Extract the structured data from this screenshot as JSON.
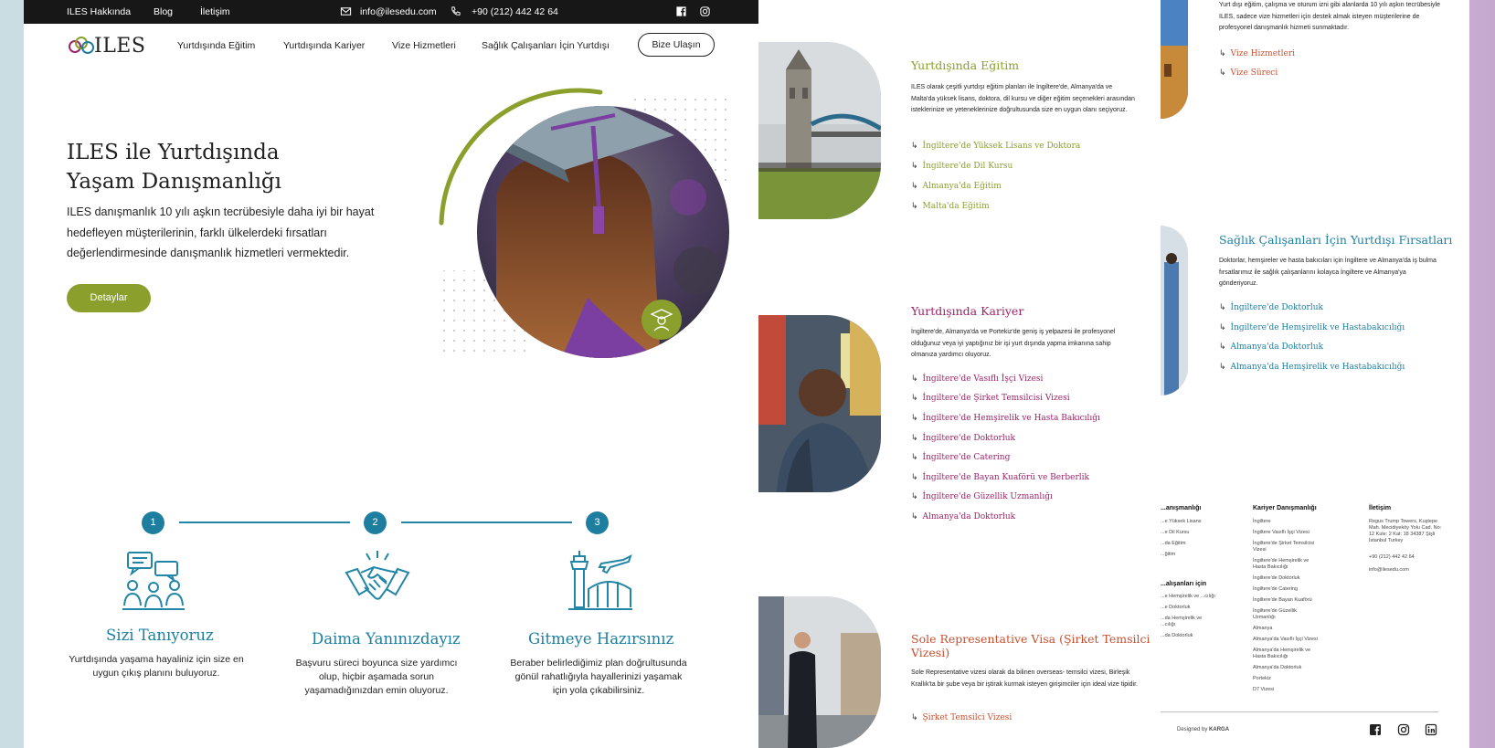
{
  "topbar": {
    "links": [
      "ILES Hakkında",
      "Blog",
      "İletişim"
    ],
    "email": "info@ilesedu.com",
    "phone": "+90 (212) 442 42 64"
  },
  "header": {
    "logo_text": "ILES",
    "nav": [
      "Yurtdışında Eğitim",
      "Yurtdışında Kariyer",
      "Vize Hizmetleri",
      "Sağlık Çalışanları İçin Yurtdışı"
    ],
    "cta": "Bize Ulaşın"
  },
  "hero": {
    "title_line1": "ILES ile Yurtdışında",
    "title_line2": "Yaşam Danışmanlığı",
    "text": "ILES danışmanlık 10 yılı aşkın tecrübesiyle daha iyi bir hayat hedefleyen müşterilerinin, farklı ülkelerdeki fırsatları değerlendirmesinde danışmanlık hizmetleri vermektedir.",
    "button": "Detaylar"
  },
  "steps": [
    "1",
    "2",
    "3"
  ],
  "features": [
    {
      "title": "Sizi Tanıyoruz",
      "text": "Yurtdışında yaşama hayaliniz için size en uygun çıkış planını buluyoruz."
    },
    {
      "title": "Daima Yanınızdayız",
      "text": "Başvuru süreci boyunca size yardımcı olup, hiçbir aşamada sorun yaşamadığınızdan emin oluyoruz."
    },
    {
      "title": "Gitmeye Hazırsınız",
      "text": "Beraber belirlediğimiz plan doğrultusunda gönül rahatlığıyla hayallerinizi yaşamak için yola çıkabilirsiniz."
    }
  ],
  "sections": [
    {
      "title": "Yurtdışında Eğitim",
      "text": "ILES olarak çeşitli yurtdışı eğitim planları ile İngiltere'de, Almanya'da ve Malta'da yüksek lisans, doktora, dil kursu ve diğer eğitim seçenekleri arasından isteklerinize ve yeteneklerinize doğrultusunda size en uygun olanı seçiyoruz.",
      "links": [
        "İngiltere'de Yüksek Lisans ve Doktora",
        "İngiltere'de Dil Kursu",
        "Almanya'da Eğitim",
        "Malta'da Eğitim"
      ]
    },
    {
      "title": "Yurtdışında Kariyer",
      "text": "İngiltere'de, Almanya'da ve Portekiz'de geniş iş yelpazesi ile profesyonel olduğunuz veya iyi yaptığınız bir işi yurt dışında yapma imkanına sahip olmanıza yardımcı oluyoruz.",
      "links": [
        "İngiltere'de Vasıflı İşçi Vizesi",
        "İngiltere'de Şirket Temsilcisi Vizesi",
        "İngiltere'de Hemşirelik ve Hasta Bakıcılığı",
        "İngiltere'de Doktorluk",
        "İngiltere'de Catering",
        "İngiltere'de Bayan Kuaförü ve Berberlik",
        "İngiltere'de Güzellik Uzmanlığı",
        "Almanya'da Doktorluk"
      ]
    },
    {
      "title_line1": "Sole Representative Visa (Şirket Temsilci",
      "title_line2": "Vizesi)",
      "text": "Sole Representative vizesi olarak da bilinen overseas- temsilci vizesi, Birleşik Krallık'ta bir şube veya bir iştirak kurmak isteyen girişimciler için ideal vize tipidir.",
      "links": [
        "Şirket Temsilci Vizesi"
      ]
    }
  ],
  "visa": {
    "text": "Yurt dışı eğitim, çalışma ve oturum izni gibi alanlarda 10 yılı aşkın tecrübesiyle ILES, sadece vize hizmetleri için destek almak isteyen müşterilerine de profesyonel danışmanlık hizmeti sunmaktadır.",
    "links": [
      "Vize Hizmetleri",
      "Vize Süreci"
    ]
  },
  "health": {
    "title": "Sağlık Çalışanları İçin Yurtdışı Fırsatları",
    "text": "Doktorlar, hemşireler ve hasta bakıcıları için İngiltere ve Almanya'da iş bulma fırsatlarımız ile sağlık çalışanlarını kolayca İngiltere ve Almanya'ya gönderiyoruz.",
    "links": [
      "İngiltere'de Doktorluk",
      "İngiltere'de Hemşirelik ve Hastabakıcılığı",
      "Almanya'da Doktorluk",
      "Almanya'da Hemşirelik ve Hastabakıcılığı"
    ]
  },
  "footer": {
    "col1_title": "...anışmanlığı",
    "col1_items": [
      "...e Yüksek Lisans",
      "...e Dil Kursu",
      "...da Eğitim",
      "...ğitim"
    ],
    "col1b_title": "...alışanları için",
    "col1b_items": [
      "...e Hemşirelik ve ...cılığı",
      "...e Doktorluk",
      "...da Hemşirelik ve ...cılığı",
      "...da Doktorluk"
    ],
    "col2_title": "Kariyer Danışmanlığı",
    "col2_items": [
      "İngiltere",
      "İngiltere Vasıflı İşçi Vizesi",
      "İngiltere'de Şirket Temsilcisi Vizesi",
      "İngiltere'de Hemşirelik ve Hasta Bakıcılığı",
      "İngiltere'de Doktorluk",
      "İngiltere'de Catering",
      "İngiltere'de Bayan Kuaförü",
      "İngiltere'de Güzellik Uzmanlığı",
      "Almanya",
      "Almanya'da Vasıflı İşçi Vizesi",
      "Almanya'da Hemşirelik ve Hasta Bakıcılığı",
      "Almanya'da Doktorluk",
      "Portekiz",
      "D7 Vizesi"
    ],
    "col3_title": "İletişim",
    "address": "Regus Trump Towers, Kuştepe Mah. Mecidiyeköy Yolu Cad. No: 12 Kule: 2 Kat: 18 34387 Şişli İstanbul Turkey",
    "phone": "+90 (212) 442 42 64",
    "email": "info@ilesedu.com",
    "designed_by": "Designed by",
    "designer": "KARGA"
  },
  "colors": {
    "green": "#8a9f2c",
    "blue": "#1e7ea0",
    "purple": "#9c2467",
    "orange": "#c8502e",
    "dark": "#171717"
  }
}
